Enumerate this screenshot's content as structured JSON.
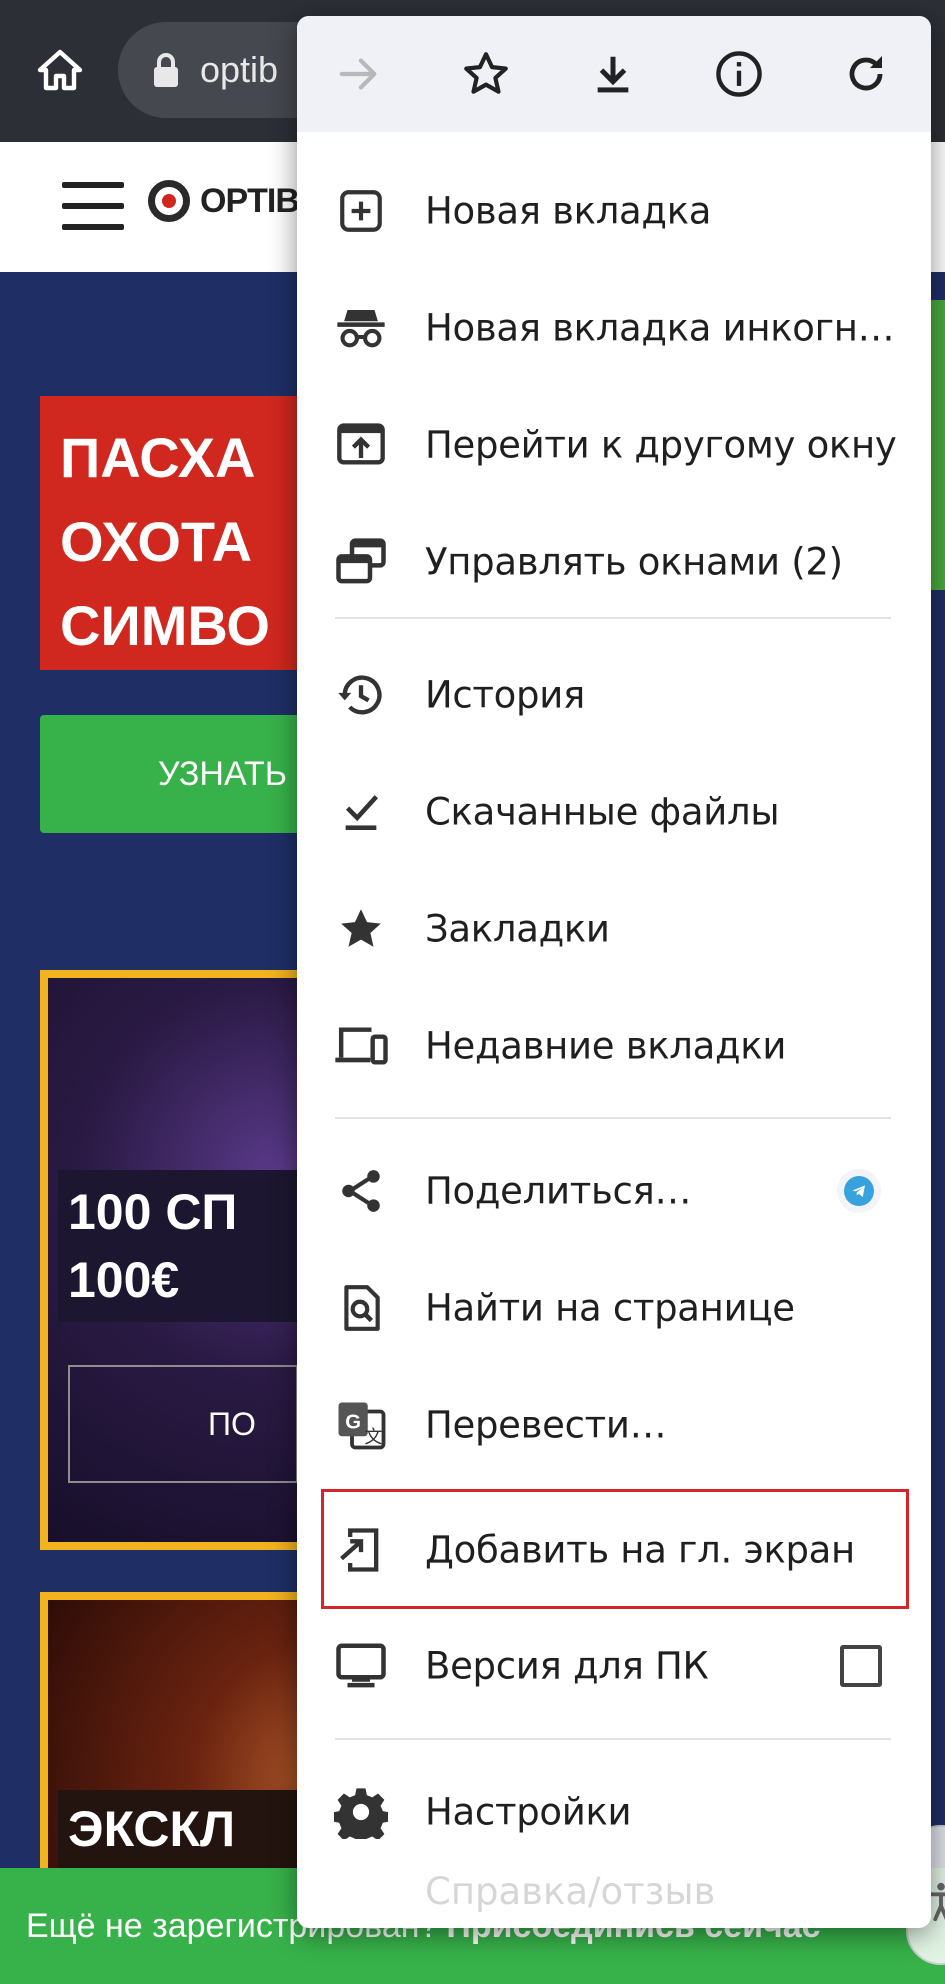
{
  "browser": {
    "url_partial": "optib"
  },
  "site": {
    "logo_text": "OPTIBE",
    "promo_lines": [
      "ПАСХА",
      "ОХОТА",
      "СИМВО"
    ],
    "promo_button": "УЗНАТЬ",
    "card1_lines": [
      "100 СП",
      "100€"
    ],
    "card1_button": "ПО",
    "card2_title": "ЭКСКЛ",
    "register_text": "Ещё не зарегистрирован?",
    "register_cta": "Присоединись сейчас"
  },
  "menu": {
    "items": [
      {
        "label": "Новая вкладка",
        "icon": "new-tab-icon"
      },
      {
        "label": "Новая вкладка инкогн…",
        "icon": "incognito-icon"
      },
      {
        "label": "Перейти к другому окну",
        "icon": "move-window-icon"
      },
      {
        "label": "Управлять окнами (2)",
        "icon": "manage-windows-icon"
      },
      {
        "label": "История",
        "icon": "history-icon"
      },
      {
        "label": "Скачанные файлы",
        "icon": "downloads-icon"
      },
      {
        "label": "Закладки",
        "icon": "bookmarks-star-icon"
      },
      {
        "label": "Недавние вкладки",
        "icon": "recent-tabs-icon"
      },
      {
        "label": "Поделиться…",
        "icon": "share-icon"
      },
      {
        "label": "Найти на странице",
        "icon": "find-in-page-icon"
      },
      {
        "label": "Перевести…",
        "icon": "translate-icon"
      },
      {
        "label": "Добавить на гл. экран",
        "icon": "add-to-home-icon"
      },
      {
        "label": "Версия для ПК",
        "icon": "desktop-icon"
      },
      {
        "label": "Настройки",
        "icon": "settings-gear-icon"
      }
    ],
    "faded_item": "Справка/отзыв"
  },
  "colors": {
    "highlight": "#d4242c",
    "accent_green": "#37b24a",
    "promo_red": "#d0281f"
  }
}
